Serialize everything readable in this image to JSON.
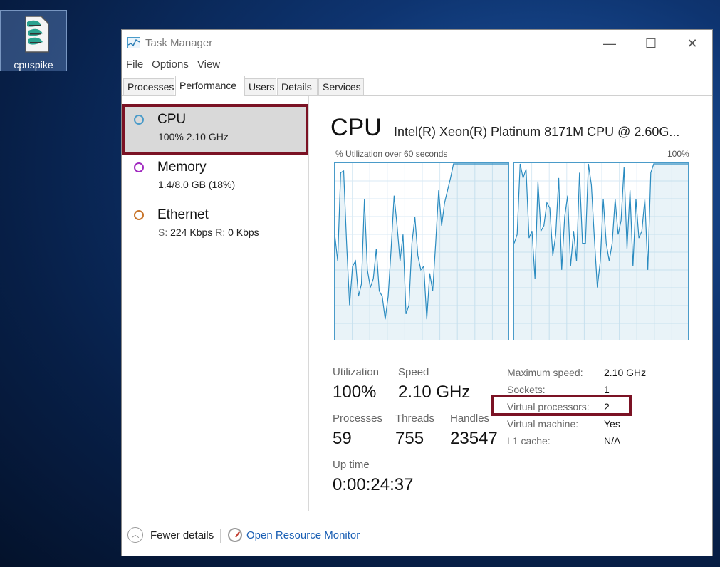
{
  "desktop": {
    "icon_label": "cpuspike"
  },
  "window": {
    "title": "Task Manager",
    "controls": {
      "minimize": "—",
      "maximize": "☐",
      "close": "✕"
    }
  },
  "menu": [
    "File",
    "Options",
    "View"
  ],
  "tabs": [
    "Processes",
    "Performance",
    "Users",
    "Details",
    "Services"
  ],
  "active_tab": "Performance",
  "resources": [
    {
      "name": "CPU",
      "detail": "100%  2.10 GHz",
      "color": "#4a9bc9",
      "selected": true
    },
    {
      "name": "Memory",
      "detail": "1.4/8.0 GB (18%)",
      "color": "#a12bc0"
    },
    {
      "name": "Ethernet",
      "detail_s_label": "S:",
      "detail_s_val": "224 Kbps",
      "detail_r_label": "R:",
      "detail_r_val": "0 Kbps",
      "color": "#c8742a"
    }
  ],
  "cpu": {
    "title": "CPU",
    "model": "Intel(R) Xeon(R) Platinum 8171M CPU @ 2.60G...",
    "graph_label": "% Utilization over 60 seconds",
    "graph_max": "100%",
    "stats": {
      "utilization_label": "Utilization",
      "utilization": "100%",
      "speed_label": "Speed",
      "speed": "2.10 GHz",
      "processes_label": "Processes",
      "processes": "59",
      "threads_label": "Threads",
      "threads": "755",
      "handles_label": "Handles",
      "handles": "23547",
      "uptime_label": "Up time",
      "uptime": "0:00:24:37"
    },
    "details": [
      {
        "k": "Maximum speed:",
        "v": "2.10 GHz"
      },
      {
        "k": "Sockets:",
        "v": "1"
      },
      {
        "k": "Virtual processors:",
        "v": "2"
      },
      {
        "k": "Virtual machine:",
        "v": "Yes"
      },
      {
        "k": "L1 cache:",
        "v": "N/A"
      }
    ]
  },
  "footer": {
    "fewer": "Fewer details",
    "resource_monitor": "Open Resource Monitor"
  },
  "chart_data": [
    {
      "type": "line",
      "name": "CPU 0",
      "ylim": [
        0,
        100
      ],
      "values": [
        60,
        45,
        95,
        96,
        55,
        20,
        42,
        45,
        25,
        32,
        80,
        40,
        30,
        35,
        52,
        28,
        25,
        12,
        25,
        52,
        82,
        65,
        45,
        60,
        15,
        20,
        55,
        70,
        48,
        40,
        42,
        12,
        38,
        28,
        55,
        85,
        65,
        78,
        85,
        92,
        100,
        100,
        100,
        100,
        100,
        100,
        100,
        100,
        100,
        100,
        100,
        100,
        100,
        100,
        100,
        100,
        100,
        100,
        100,
        100
      ]
    },
    {
      "type": "line",
      "name": "CPU 1",
      "ylim": [
        0,
        100
      ],
      "values": [
        55,
        60,
        100,
        92,
        97,
        58,
        62,
        35,
        90,
        62,
        65,
        78,
        75,
        48,
        60,
        92,
        40,
        70,
        82,
        42,
        62,
        45,
        95,
        55,
        55,
        100,
        88,
        58,
        30,
        45,
        80,
        55,
        45,
        55,
        80,
        60,
        68,
        98,
        52,
        85,
        42,
        80,
        58,
        62,
        80,
        40,
        95,
        100,
        100,
        100,
        100,
        100,
        100,
        100,
        100,
        100,
        100,
        100,
        100,
        100
      ]
    }
  ]
}
